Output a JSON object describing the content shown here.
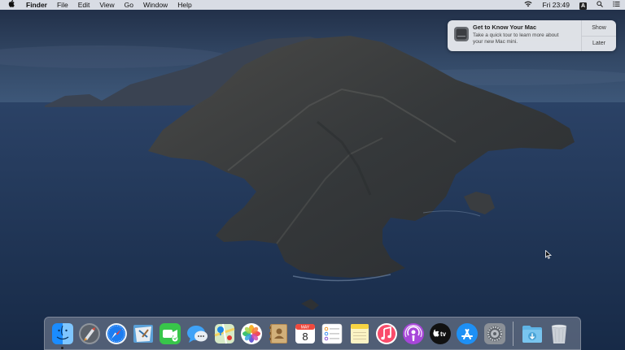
{
  "menubar": {
    "apple_icon": "apple-icon",
    "app_name": "Finder",
    "menus": [
      "File",
      "Edit",
      "View",
      "Go",
      "Window",
      "Help"
    ],
    "clock": "Fri 23:49",
    "input_source": "A",
    "status_icons": [
      "wifi-icon",
      "input-source-icon",
      "spotlight-icon",
      "notification-center-icon"
    ]
  },
  "notification": {
    "icon": "mac-mini-icon",
    "title": "Get to Know Your Mac",
    "message_line1": "Take a quick tour to learn more about",
    "message_line2": "your new Mac mini.",
    "show_label": "Show",
    "later_label": "Later"
  },
  "dock": {
    "items": [
      {
        "name": "Finder",
        "icon": "finder-icon",
        "running": true
      },
      {
        "name": "Launchpad",
        "icon": "launchpad-icon"
      },
      {
        "name": "Safari",
        "icon": "safari-icon"
      },
      {
        "name": "Mail",
        "icon": "mail-icon"
      },
      {
        "name": "FaceTime",
        "icon": "facetime-icon"
      },
      {
        "name": "Messages",
        "icon": "messages-icon"
      },
      {
        "name": "Maps",
        "icon": "maps-icon"
      },
      {
        "name": "Photos",
        "icon": "photos-icon"
      },
      {
        "name": "Contacts",
        "icon": "contacts-icon"
      },
      {
        "name": "Calendar",
        "icon": "calendar-icon",
        "month": "MAY",
        "day": "8"
      },
      {
        "name": "Reminders",
        "icon": "reminders-icon"
      },
      {
        "name": "Notes",
        "icon": "notes-icon"
      },
      {
        "name": "Music",
        "icon": "music-icon"
      },
      {
        "name": "Podcasts",
        "icon": "podcasts-icon"
      },
      {
        "name": "TV",
        "icon": "tv-icon",
        "label": "tv"
      },
      {
        "name": "App Store",
        "icon": "app-store-icon"
      },
      {
        "name": "System Preferences",
        "icon": "system-preferences-icon"
      },
      {
        "name": "Downloads",
        "icon": "downloads-folder-icon"
      },
      {
        "name": "Trash",
        "icon": "trash-icon"
      }
    ]
  },
  "colors": {
    "menubar_bg": "#e8ecf2",
    "sky": "#2c3e5c",
    "sea": "#22385a",
    "island": "#3d3f40"
  }
}
